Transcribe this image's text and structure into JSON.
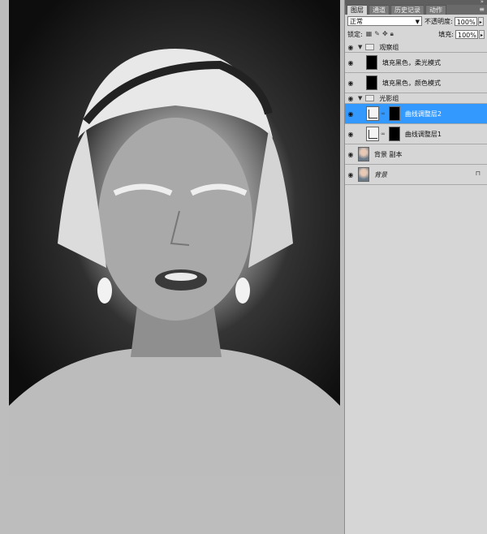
{
  "panel": {
    "tabs": [
      {
        "label": "图层",
        "active": true
      },
      {
        "label": "通道",
        "active": false
      },
      {
        "label": "历史记录",
        "active": false
      },
      {
        "label": "动作",
        "active": false
      }
    ],
    "blend_mode": "正常",
    "opacity_label": "不透明度:",
    "opacity_value": "100%",
    "lock_label": "锁定:",
    "fill_label": "填充:",
    "fill_value": "100%"
  },
  "layers": [
    {
      "name": "观察组",
      "type": "group"
    },
    {
      "name": "填充黑色，柔光模式",
      "type": "fill"
    },
    {
      "name": "填充黑色，颜色模式",
      "type": "fill"
    },
    {
      "name": "光影组",
      "type": "group"
    },
    {
      "name": "曲线调整层2",
      "type": "curves",
      "selected": true
    },
    {
      "name": "曲线调整层1",
      "type": "curves"
    },
    {
      "name": "背景 副本",
      "type": "photo"
    },
    {
      "name": "背景",
      "type": "photo",
      "locked": true
    }
  ],
  "colors": {
    "selected": "#3399ff",
    "panel_bg": "#d6d6d6"
  }
}
